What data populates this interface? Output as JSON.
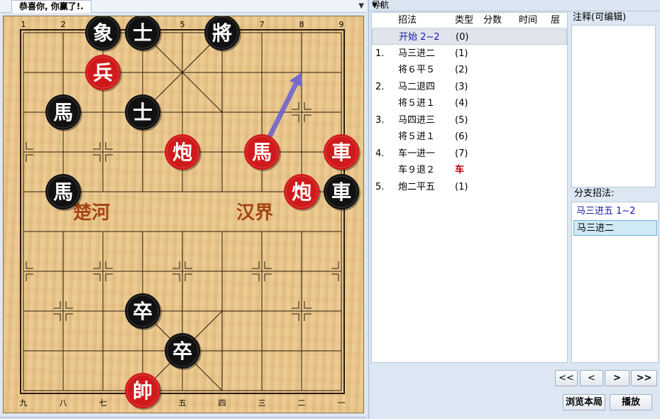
{
  "left_tab": {
    "title": "恭喜你, 你赢了!.",
    "pin": "▼"
  },
  "board": {
    "top_files": [
      "1",
      "2",
      "3",
      "4",
      "5",
      "6",
      "7",
      "8",
      "9"
    ],
    "bottom_files": [
      "九",
      "八",
      "七",
      "六",
      "五",
      "四",
      "三",
      "二",
      "一"
    ],
    "river_left": "楚河",
    "river_right": "汉界",
    "pieces": [
      {
        "char": "象",
        "side": "black",
        "file": 3,
        "rank": 0
      },
      {
        "char": "士",
        "side": "black",
        "file": 4,
        "rank": 0
      },
      {
        "char": "將",
        "side": "black",
        "file": 6,
        "rank": 0
      },
      {
        "char": "兵",
        "side": "red",
        "file": 3,
        "rank": 1
      },
      {
        "char": "馬",
        "side": "black",
        "file": 2,
        "rank": 2
      },
      {
        "char": "士",
        "side": "black",
        "file": 4,
        "rank": 2
      },
      {
        "char": "炮",
        "side": "red",
        "file": 5,
        "rank": 3
      },
      {
        "char": "馬",
        "side": "red",
        "file": 7,
        "rank": 3
      },
      {
        "char": "車",
        "side": "red",
        "file": 9,
        "rank": 3
      },
      {
        "char": "馬",
        "side": "black",
        "file": 2,
        "rank": 4
      },
      {
        "char": "炮",
        "side": "red",
        "file": 8,
        "rank": 4
      },
      {
        "char": "車",
        "side": "black",
        "file": 9,
        "rank": 4
      },
      {
        "char": "卒",
        "side": "black",
        "file": 4,
        "rank": 7
      },
      {
        "char": "卒",
        "side": "black",
        "file": 5,
        "rank": 8
      },
      {
        "char": "帥",
        "side": "red",
        "file": 4,
        "rank": 9
      }
    ],
    "arrow": {
      "from_file": 7,
      "from_rank": 3,
      "to_file": 8,
      "to_rank": 1,
      "color": "#6a5fd0"
    },
    "colors": {
      "red_piece": "#d0191b",
      "black_piece": "#111111"
    }
  },
  "nav": {
    "title": "导航",
    "pins": "▼ ‡",
    "headers": {
      "move": "招法",
      "type": "类型",
      "score": "分数",
      "time": "时间",
      "depth": "层"
    },
    "rows": [
      {
        "num": "",
        "move": "开始 2~2",
        "type": "(0)",
        "selected": true
      },
      {
        "num": "1.",
        "move": "马三进二",
        "type": "(1)"
      },
      {
        "num": "",
        "move": "将６平５",
        "type": "(2)"
      },
      {
        "num": "2.",
        "move": "马二退四",
        "type": "(3)"
      },
      {
        "num": "",
        "move": "将５进１",
        "type": "(4)"
      },
      {
        "num": "3.",
        "move": "马四进三",
        "type": "(5)"
      },
      {
        "num": "",
        "move": "将５进１",
        "type": "(6)"
      },
      {
        "num": "4.",
        "move": "车一进一",
        "type": "(7)"
      },
      {
        "num": "",
        "move": "车９退２",
        "type": "车",
        "type_color": "#c00000"
      },
      {
        "num": "5.",
        "move": "炮二平五",
        "type": "(1)"
      }
    ]
  },
  "annotation": {
    "label": "注释(可编辑)"
  },
  "branch": {
    "label": "分支招法:",
    "items": [
      {
        "text": "马三进五 1~2",
        "color": "#1a1aa8",
        "selected": false
      },
      {
        "text": "马三进二",
        "color": "#000000",
        "selected": true
      }
    ]
  },
  "buttons": {
    "first": "<<",
    "prev": "<",
    "next": ">",
    "last": ">>",
    "browse": "浏览本局",
    "play": "播放"
  }
}
